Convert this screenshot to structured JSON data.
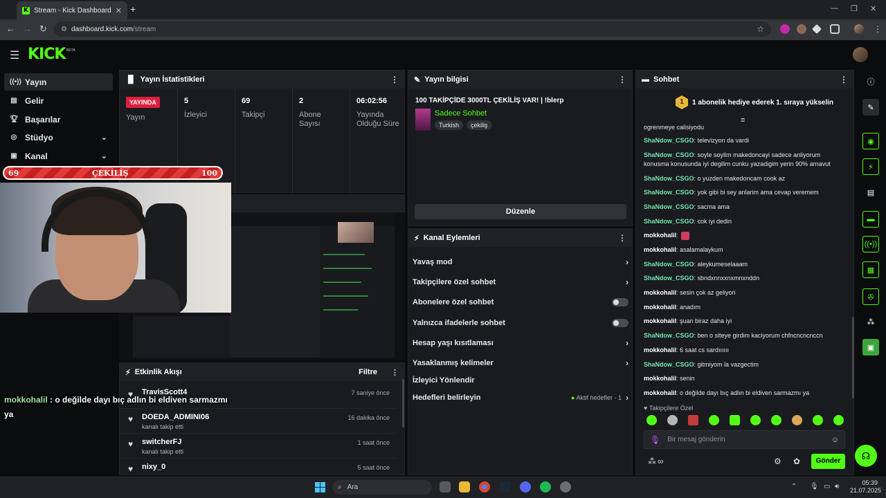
{
  "browser": {
    "tab_title": "Stream - Kick Dashboard",
    "tab_favicon": "K",
    "url_host": "dashboard.kick.com",
    "url_path": "/stream"
  },
  "brand": {
    "logo": "KICK",
    "beta": "BETA",
    "accent": "#53fc18"
  },
  "sidebar": {
    "items": [
      {
        "label": "Yayın",
        "icon": "broadcast-icon"
      },
      {
        "label": "Gelir",
        "icon": "revenue-icon"
      },
      {
        "label": "Başarılar",
        "icon": "trophy-icon"
      },
      {
        "label": "Stüdyo",
        "icon": "studio-icon"
      },
      {
        "label": "Kanal",
        "icon": "channel-icon"
      }
    ]
  },
  "giveaway": {
    "left": "69",
    "label": "ÇEKİLİŞ",
    "right": "100"
  },
  "stats": {
    "title": "Yayın İstatistikleri",
    "live_badge": "YAYINDA",
    "live_label": "Yayın",
    "viewers": "5",
    "viewers_label": "İzleyici",
    "followers": "69",
    "followers_label": "Takipçi",
    "subs": "2",
    "subs_label": "Abone Sayısı",
    "uptime": "06:02:56",
    "uptime_label": "Yayında Olduğu Süre"
  },
  "activity": {
    "title": "Etkinlik Akışı",
    "filter": "Filtre",
    "items": [
      {
        "name": "TravisScott4",
        "desc": "",
        "time": "7 saniye önce"
      },
      {
        "name": "DOEDA_ADMINI06",
        "desc": "kanalı takip etti",
        "time": "16 dakika önce"
      },
      {
        "name": "switcherFJ",
        "desc": "kanalı takip etti",
        "time": "1 saat önce"
      },
      {
        "name": "nixy_0",
        "desc": "",
        "time": "5 saat önce"
      }
    ]
  },
  "overlay_chat": {
    "user": "mokkohalil",
    "text": " : o değilde dayı bıç adlın bi eldiven sarmazmı ya"
  },
  "info": {
    "title": "Yayın bilgisi",
    "stream_title": "100 TAKİPÇİDE 3000TL ÇEKİLİŞ VAR! | !blerp",
    "category": "Sadece Sohbet",
    "tags": [
      "Turkish",
      "çekiliş"
    ],
    "edit": "Düzenle"
  },
  "actions": {
    "title": "Kanal Eylemleri",
    "rows": [
      {
        "label": "Yavaş mod",
        "kind": "chevron"
      },
      {
        "label": "Takipçilere özel sohbet",
        "kind": "chevron"
      },
      {
        "label": "Abonelere özel sohbet",
        "kind": "toggle"
      },
      {
        "label": "Yalnızca ifadelerle sohbet",
        "kind": "toggle"
      },
      {
        "label": "Hesap yaşı kısıtlaması",
        "kind": "chevron"
      },
      {
        "label": "Yasaklanmış kelimeler",
        "kind": "chevron"
      },
      {
        "label": "İzleyici Yönlendir",
        "kind": "none"
      },
      {
        "label": "Hedefleri belirleyin",
        "kind": "goal"
      }
    ],
    "goal_status": "Aktif hedefler - 1"
  },
  "chat": {
    "title": "Sohbet",
    "gift_banner": "1 abonelik hediye ederek 1. sıraya yükselin",
    "gift_rank": "1",
    "messages": [
      {
        "user": "",
        "text": "ogrenmeye calisiyodu",
        "color": "#e6e6e6"
      },
      {
        "user": "ShaNdow_CSGO",
        "text": ": televizyon da vardi",
        "color": "#75e7b0"
      },
      {
        "user": "ShaNdow_CSGO",
        "text": ": soyle soylim makedoncayi sadece anliyorum konusma konusunda iyi degilim cunku yazadigim yerin 90% arnavut",
        "color": "#75e7b0"
      },
      {
        "user": "ShaNdow_CSGO",
        "text": ": o yuzden makedoncam cook az",
        "color": "#75e7b0"
      },
      {
        "user": "ShaNdow_CSGO",
        "text": ": yok gibi bi sey anlarim ama cevap veremem",
        "color": "#75e7b0"
      },
      {
        "user": "ShaNdow_CSGO",
        "text": ": sacma ama",
        "color": "#75e7b0"
      },
      {
        "user": "ShaNdow_CSGO",
        "text": ": cok iyi dedin",
        "color": "#75e7b0"
      },
      {
        "user": "mokkohalil",
        "text": ":",
        "color": "#ffffff",
        "emote": true
      },
      {
        "user": "mokkohalil",
        "text": ": asalamalaykum",
        "color": "#ffffff"
      },
      {
        "user": "ShaNdow_CSGO",
        "text": ": aleykumeselaaam",
        "color": "#75e7b0"
      },
      {
        "user": "ShaNdow_CSGO",
        "text": ": sbndxnnxxnxmnxnddn",
        "color": "#75e7b0"
      },
      {
        "user": "mokkohalil",
        "text": ": sesin çok az geliyori",
        "color": "#ffffff"
      },
      {
        "user": "mokkohalil",
        "text": ": anadım",
        "color": "#ffffff"
      },
      {
        "user": "mokkohalil",
        "text": ": şuan biraz daha iyi",
        "color": "#ffffff"
      },
      {
        "user": "ShaNdow_CSGO",
        "text": ": ben o siteye girdim kaciyorum chfncncncnccn",
        "color": "#75e7b0"
      },
      {
        "user": "mokkohalil",
        "text": ": 6 saat cs sardıııııı",
        "color": "#ffffff"
      },
      {
        "user": "ShaNdow_CSGO",
        "text": ": gitmiyom la vazgectim",
        "color": "#75e7b0"
      },
      {
        "user": "mokkohalil",
        "text": ": senin",
        "color": "#ffffff"
      },
      {
        "user": "mokkohalil",
        "text": ": o değilde dayı bıç adlın bi eldiven sarmazmı ya",
        "color": "#ffffff"
      }
    ],
    "emote_label": "Takipçilere Özel",
    "placeholder": "Bir mesaj gönderin",
    "send": "Gönder"
  },
  "taskbar": {
    "search": "Ara",
    "time": "05:39",
    "date": "21.07.2025"
  }
}
